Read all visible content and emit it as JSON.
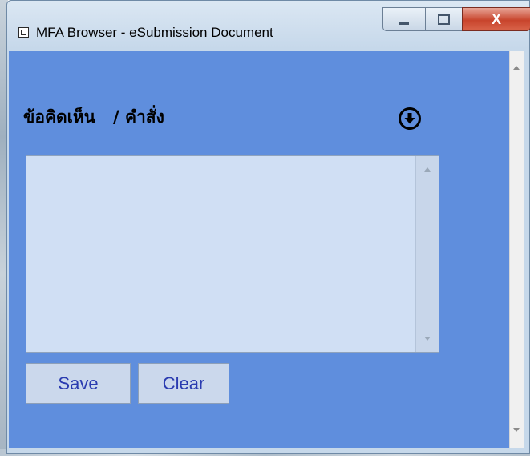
{
  "window": {
    "title": "MFA Browser - eSubmission Document",
    "minimize_glyph": "",
    "maximize_glyph": "",
    "close_glyph": "X"
  },
  "form": {
    "label": "ข้อคิดเห็น   / คำสั่ง",
    "comment_value": "",
    "save_label": "Save",
    "clear_label": "Clear"
  },
  "icons": {
    "app": "window-app-icon",
    "download": "circle-down-arrow-icon"
  },
  "colors": {
    "client_background": "#5f8edd",
    "textarea_background": "#d0dff4",
    "button_text": "#2a3bb0",
    "close_button": "#c8442c"
  }
}
